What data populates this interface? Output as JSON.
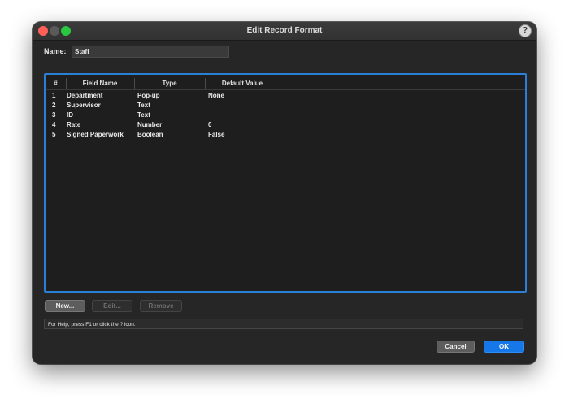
{
  "window": {
    "title": "Edit Record Format",
    "help_icon": "?"
  },
  "name_field": {
    "label": "Name:",
    "value": "Staff"
  },
  "table": {
    "columns": [
      "#",
      "Field Name",
      "Type",
      "Default Value"
    ],
    "rows": [
      {
        "num": "1",
        "field": "Department",
        "type": "Pop-up",
        "default": "None"
      },
      {
        "num": "2",
        "field": "Supervisor",
        "type": "Text",
        "default": ""
      },
      {
        "num": "3",
        "field": "ID",
        "type": "Text",
        "default": ""
      },
      {
        "num": "4",
        "field": "Rate",
        "type": "Number",
        "default": "0"
      },
      {
        "num": "5",
        "field": "Signed Paperwork",
        "type": "Boolean",
        "default": "False"
      }
    ]
  },
  "buttons": {
    "new": "New...",
    "edit": "Edit...",
    "remove": "Remove",
    "cancel": "Cancel",
    "ok": "OK"
  },
  "status": {
    "text": "For Help, press F1 or click the ? icon."
  },
  "colors": {
    "accent": "#1577e8",
    "table_border": "#2a7fd6",
    "close": "#ff5f57",
    "maximize": "#28c840"
  }
}
